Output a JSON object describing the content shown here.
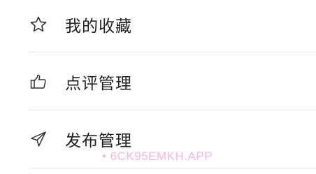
{
  "menu": {
    "items": [
      {
        "label": "我的收藏",
        "icon": "star-outline-icon"
      },
      {
        "label": "点评管理",
        "icon": "thumbs-up-outline-icon"
      },
      {
        "label": "发布管理",
        "icon": "send-paper-plane-icon"
      }
    ]
  },
  "watermark": {
    "text": "• 6CK95EMKH.APP"
  },
  "colors": {
    "text": "#222222",
    "icon_stroke": "#333333",
    "divider": "#e6e6e6",
    "watermark": "#f0b8e6"
  }
}
